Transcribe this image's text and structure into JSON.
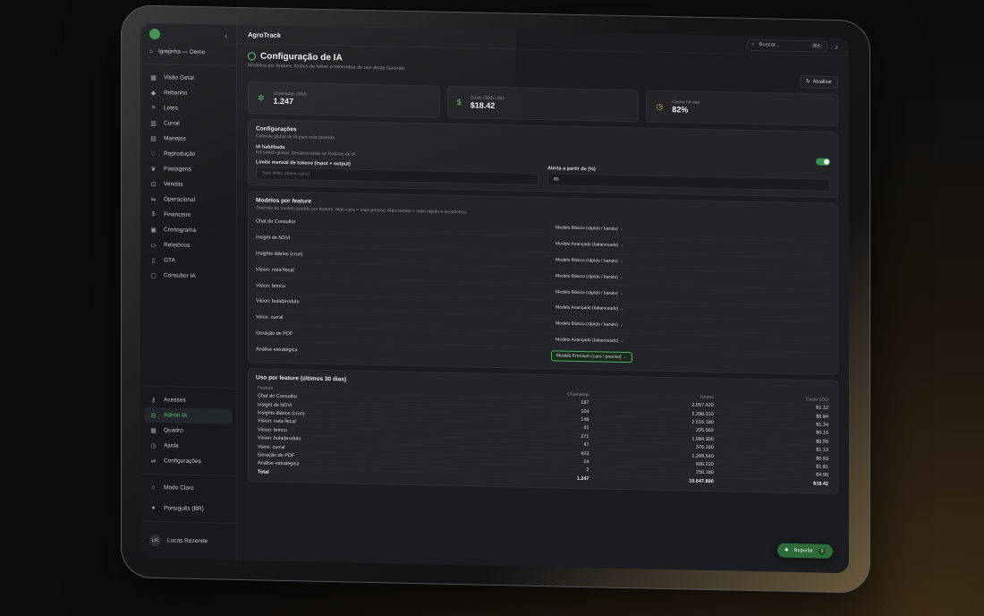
{
  "app": {
    "title": "AgroTrack"
  },
  "sidebar": {
    "farm": "Igrejinha — Demo",
    "items": [
      {
        "label": "Visão Geral",
        "icon": "grid-icon"
      },
      {
        "label": "Rebanho",
        "icon": "cattle-icon"
      },
      {
        "label": "Lotes",
        "icon": "layers-icon"
      },
      {
        "label": "Curral",
        "icon": "fence-icon"
      },
      {
        "label": "Manejos",
        "icon": "clipboard-icon"
      },
      {
        "label": "Reprodução",
        "icon": "heart-icon"
      },
      {
        "label": "Pastagens",
        "icon": "leaf-icon"
      },
      {
        "label": "Vendas",
        "icon": "cart-icon"
      },
      {
        "label": "Operacional",
        "icon": "sliders-icon"
      },
      {
        "label": "Financeiro",
        "icon": "dollar-icon"
      },
      {
        "label": "Cronograma",
        "icon": "calendar-icon"
      },
      {
        "label": "Relatórios",
        "icon": "report-icon"
      },
      {
        "label": "GTA",
        "icon": "document-icon"
      },
      {
        "label": "Consultor IA",
        "icon": "chat-icon"
      }
    ],
    "bottom_items": [
      {
        "label": "Acessos",
        "icon": "key-icon"
      },
      {
        "label": "Admin IA",
        "icon": "ai-icon",
        "active": true
      },
      {
        "label": "Quadro",
        "icon": "board-icon"
      },
      {
        "label": "Ajuda",
        "icon": "help-icon"
      },
      {
        "label": "Configurações",
        "icon": "settings-icon"
      }
    ],
    "theme": "Modo Claro",
    "language": "Português (BR)",
    "user": {
      "initials": "LR",
      "name": "Lucas Rezende"
    }
  },
  "topbar": {
    "search_placeholder": "Buscar...",
    "shortcut": "⌘K"
  },
  "page": {
    "title": "Configuração de IA",
    "subtitle": "Modelos por feature, limites de token e telemetria de uso desta fazenda.",
    "refresh_label": "Atualizar"
  },
  "stats": [
    {
      "label": "Chamadas (30d)",
      "value": "1.247"
    },
    {
      "label": "Custo (30d) USD",
      "value": "$18.42"
    },
    {
      "label": "Cache hit rate",
      "value": "82%"
    }
  ],
  "config": {
    "title": "Configurações",
    "subtitle": "Controle global de IA para esta fazenda.",
    "ai_enabled_label": "IA habilitada",
    "ai_enabled_hint": "Kill switch global. Desativa todas as features de IA.",
    "ai_enabled": true,
    "token_limit_label": "Limite mensal de tokens (input + output)",
    "token_limit_placeholder": "Sem limite (deixe vazio)",
    "alert_label": "Alerta a partir de (%)",
    "alert_value": "80"
  },
  "models": {
    "title": "Modelos por feature",
    "subtitle": "Override do modelo padrão por feature. Mais caro = mais preciso. Mais barato = mais rápido e econômico.",
    "rows": [
      {
        "feature": "Chat do Consultor",
        "model": "Modelo Básico (rápido / barato)"
      },
      {
        "feature": "Insight de NDVI",
        "model": "Modelo Avançado (balanceado)"
      },
      {
        "feature": "Insights diários (cron)",
        "model": "Modelo Básico (rápido / barato)"
      },
      {
        "feature": "Vision: nota fiscal",
        "model": "Modelo Básico (rápido / barato)"
      },
      {
        "feature": "Vision: brinco",
        "model": "Modelo Básico (rápido / barato)"
      },
      {
        "feature": "Vision: bula/produto",
        "model": "Modelo Avançado (balanceado)"
      },
      {
        "feature": "Voice: curral",
        "model": "Modelo Básico (rápido / barato)"
      },
      {
        "feature": "Geração de PDF",
        "model": "Modelo Avançado (balanceado)"
      },
      {
        "feature": "Análise estratégica",
        "model": "Modelo Premium (caro / preciso)",
        "highlight": true
      }
    ]
  },
  "usage": {
    "title": "Uso por feature (últimos 30 dias)",
    "columns": [
      "Feature",
      "Chamadas",
      "Tokens",
      "Custo USD"
    ],
    "rows": [
      [
        "Chat do Consultor",
        "187",
        "2.057.420",
        "$1.12"
      ],
      [
        "Insight de NDVI",
        "104",
        "2.288.310",
        "$6.84"
      ],
      [
        "Insights diários (cron)",
        "148",
        "2.516.180",
        "$1.34"
      ],
      [
        "Vision: nota fiscal",
        "41",
        "205.560",
        "$0.10"
      ],
      [
        "Vision: brinco",
        "271",
        "1.084.300",
        "$0.55"
      ],
      [
        "Vision: bula/produto",
        "47",
        "376.160",
        "$1.13"
      ],
      [
        "Voice: curral",
        "423",
        "1.269.540",
        "$0.63"
      ],
      [
        "Geração de PDF",
        "24",
        "600.220",
        "$1.81"
      ],
      [
        "Análise estratégica",
        "2",
        "250.180",
        "$4.90"
      ]
    ],
    "total": [
      "Total",
      "1.247",
      "10.647.890",
      "$18.42"
    ]
  },
  "report_button": {
    "label": "Reportar",
    "count": "3"
  },
  "colors": {
    "accent": "#5cc26f",
    "background": "#1b1c1f",
    "panel": "#222428"
  }
}
